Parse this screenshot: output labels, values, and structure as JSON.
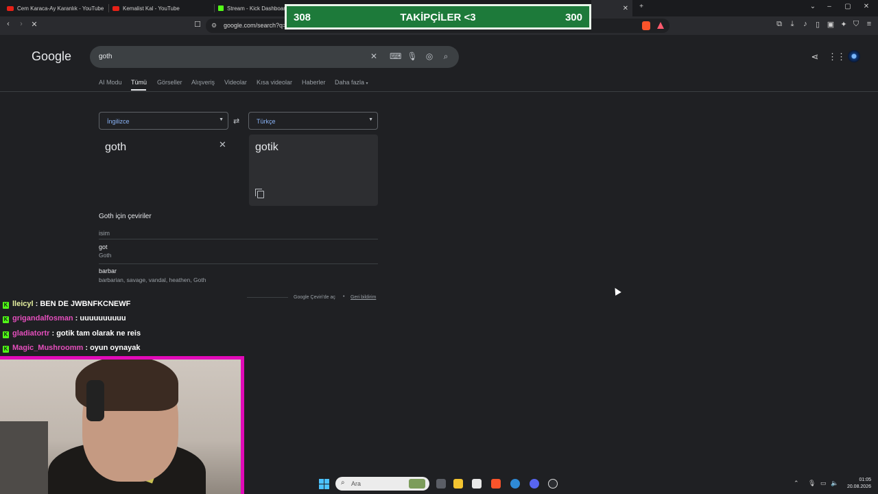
{
  "browser": {
    "tabs": [
      {
        "title": "Cem Karaca-Ay Karanlık - YouTube",
        "favicon": "youtube-icon"
      },
      {
        "title": "Kemalist Kal - YouTube",
        "favicon": "youtube-icon"
      },
      {
        "title": "Stream - Kick Dashboard",
        "favicon": "kick-icon"
      }
    ],
    "url": "google.com/search?q="
  },
  "overlay": {
    "left_count": "308",
    "title": "TAKİPÇİLER <3",
    "right_count": "300",
    "color": "#1d7a3a"
  },
  "google": {
    "logo": "Google",
    "query": "goth",
    "nav": [
      "AI Modu",
      "Tümü",
      "Görseller",
      "Alışveriş",
      "Videolar",
      "Kısa videolar",
      "Haberler",
      "Daha fazla"
    ],
    "active_nav": "Tümü"
  },
  "translate": {
    "source_lang": "İngilizce",
    "target_lang": "Türkçe",
    "source_text": "goth",
    "target_text": "gotik",
    "translations_title": "Goth için çeviriler",
    "pos": "isim",
    "entries": [
      {
        "word": "got",
        "synonyms": "Goth"
      },
      {
        "word": "barbar",
        "synonyms": "barbarian, savage, vandal, heathen, Goth"
      }
    ],
    "footer_link": "Google Çeviri'de aç",
    "footer_separator": "•",
    "feedback": "Geri bildirim"
  },
  "chat": [
    {
      "user": "lleicyl",
      "sep": " : ",
      "message": "BEN DE JWBNFKCNEWF",
      "color": "#e7f2a0"
    },
    {
      "user": "grigandalfosman",
      "sep": " : ",
      "message": "uuuuuuuuuu",
      "color": "#e54fbd"
    },
    {
      "user": "gladiatortr",
      "sep": " : ",
      "message": "gotik tam olarak ne reis",
      "color": "#e54fbd"
    },
    {
      "user": "Magic_Mushroomm",
      "sep": " : ",
      "message": "oyun oynayak",
      "color": "#e54fbd"
    }
  ],
  "taskbar": {
    "search_placeholder": "Ara",
    "time": "01:05",
    "date": "20.08.2026"
  }
}
